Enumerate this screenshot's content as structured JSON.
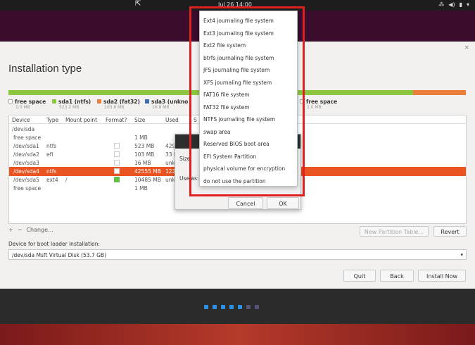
{
  "topbar": {
    "clock": "Jul 26 14:00",
    "tray": [
      "⁂",
      "◀)",
      "▮",
      "▾"
    ]
  },
  "window": {
    "title": "Installation type",
    "close": "×"
  },
  "legend": [
    {
      "name": "free space",
      "size": "1.0 MB",
      "color": "#ffffff"
    },
    {
      "name": "sda1 (ntfs)",
      "size": "523.2 MB",
      "color": "#8dc63f"
    },
    {
      "name": "sda2 (fat32)",
      "size": "103.8 MB",
      "color": "#e97f3a"
    },
    {
      "name": "sda3 (unkno",
      "size": "16.8 MB",
      "color": "#3b6fb5"
    },
    {
      "name": "free space",
      "size": "1.0 MB",
      "color": "#ffffff"
    }
  ],
  "table": {
    "headers": [
      "Device",
      "Type",
      "Mount point",
      "Format?",
      "Size",
      "Used",
      "S"
    ],
    "rows": [
      {
        "device": "/dev/sda",
        "type": "",
        "mount": "",
        "format": null,
        "size": "",
        "used": ""
      },
      {
        "device": "free space",
        "type": "",
        "mount": "",
        "format": null,
        "size": "1 MB",
        "used": ""
      },
      {
        "device": "/dev/sda1",
        "type": "ntfs",
        "mount": "",
        "format": false,
        "size": "523 MB",
        "used": "429"
      },
      {
        "device": "/dev/sda2",
        "type": "efi",
        "mount": "",
        "format": false,
        "size": "103 MB",
        "used": "33 M"
      },
      {
        "device": "/dev/sda3",
        "type": "",
        "mount": "",
        "format": false,
        "size": "16 MB",
        "used": "unk"
      },
      {
        "device": "/dev/sda4",
        "type": "ntfs",
        "mount": "",
        "format": false,
        "size": "42555 MB",
        "used": "122"
      },
      {
        "device": "/dev/sda5",
        "type": "ext4",
        "mount": "/",
        "format": true,
        "size": "10485 MB",
        "used": "unk"
      },
      {
        "device": "free space",
        "type": "",
        "mount": "",
        "format": null,
        "size": "1 MB",
        "used": ""
      }
    ]
  },
  "toolbar": {
    "add": "+",
    "remove": "−",
    "change": "Change...",
    "new_table": "New Partition Table...",
    "revert": "Revert"
  },
  "boot": {
    "label": "Device for boot loader installation:",
    "value": "/dev/sda   Msft Virtual Disk (53.7 GB)"
  },
  "footer": {
    "quit": "Quit",
    "back": "Back",
    "install": "Install Now"
  },
  "dialog": {
    "size_label": "Size:",
    "use_label": "Use as:",
    "cancel": "Cancel",
    "ok": "OK"
  },
  "menu": {
    "items": [
      "Ext4 journaling file system",
      "Ext3 journaling file system",
      "Ext2 file system",
      "btrfs journaling file system",
      "JFS journaling file system",
      "XFS journaling file system",
      "FAT16 file system",
      "FAT32 file system",
      "NTFS journaling file system",
      "swap area",
      "Reserved BIOS boot area",
      "EFI System Partition",
      "physical volume for encryption",
      "do not use the partition"
    ]
  },
  "colors": {
    "accent": "#e95420",
    "highlight": "#e02020",
    "partition_green": "#8dc63f",
    "progress_dot": "#2a90e8"
  }
}
